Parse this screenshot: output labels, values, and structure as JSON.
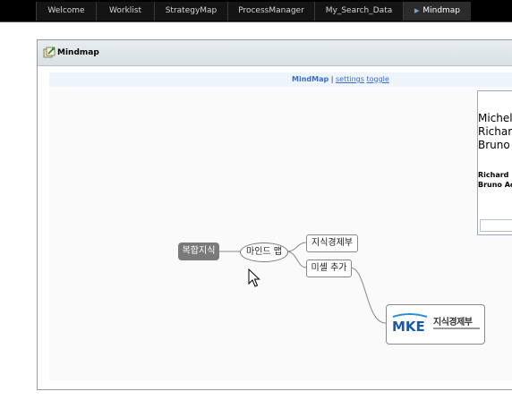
{
  "nav": {
    "tabs": [
      {
        "label": "Welcome",
        "active": false
      },
      {
        "label": "Worklist",
        "active": false
      },
      {
        "label": "StrategyMap",
        "active": false
      },
      {
        "label": "ProcessManager",
        "active": false
      },
      {
        "label": "My_Search_Data",
        "active": false
      },
      {
        "label": "Mindmap",
        "active": true
      }
    ]
  },
  "panel": {
    "title": "Mindmap",
    "icon": "mindmap-app-icon"
  },
  "toolbar": {
    "title": "MindMap",
    "separator": "|",
    "settings_link": "settings",
    "toggle_link": "toggle"
  },
  "info_box": {
    "names": [
      "Michell",
      "Richard",
      "Bruno A"
    ],
    "bold_names": [
      "Richard I",
      "Bruno Ac"
    ]
  },
  "mindmap": {
    "root": "복합지식",
    "center": "마인드 맵",
    "child1": "지식경제부",
    "child2": "미셸 추가",
    "logo_caption": "지식경제부",
    "logo_mark": "MKE"
  },
  "colors": {
    "nav_bg": "#000000",
    "accent_link": "#3c6ec8",
    "root_node": "#7a7a7a"
  }
}
